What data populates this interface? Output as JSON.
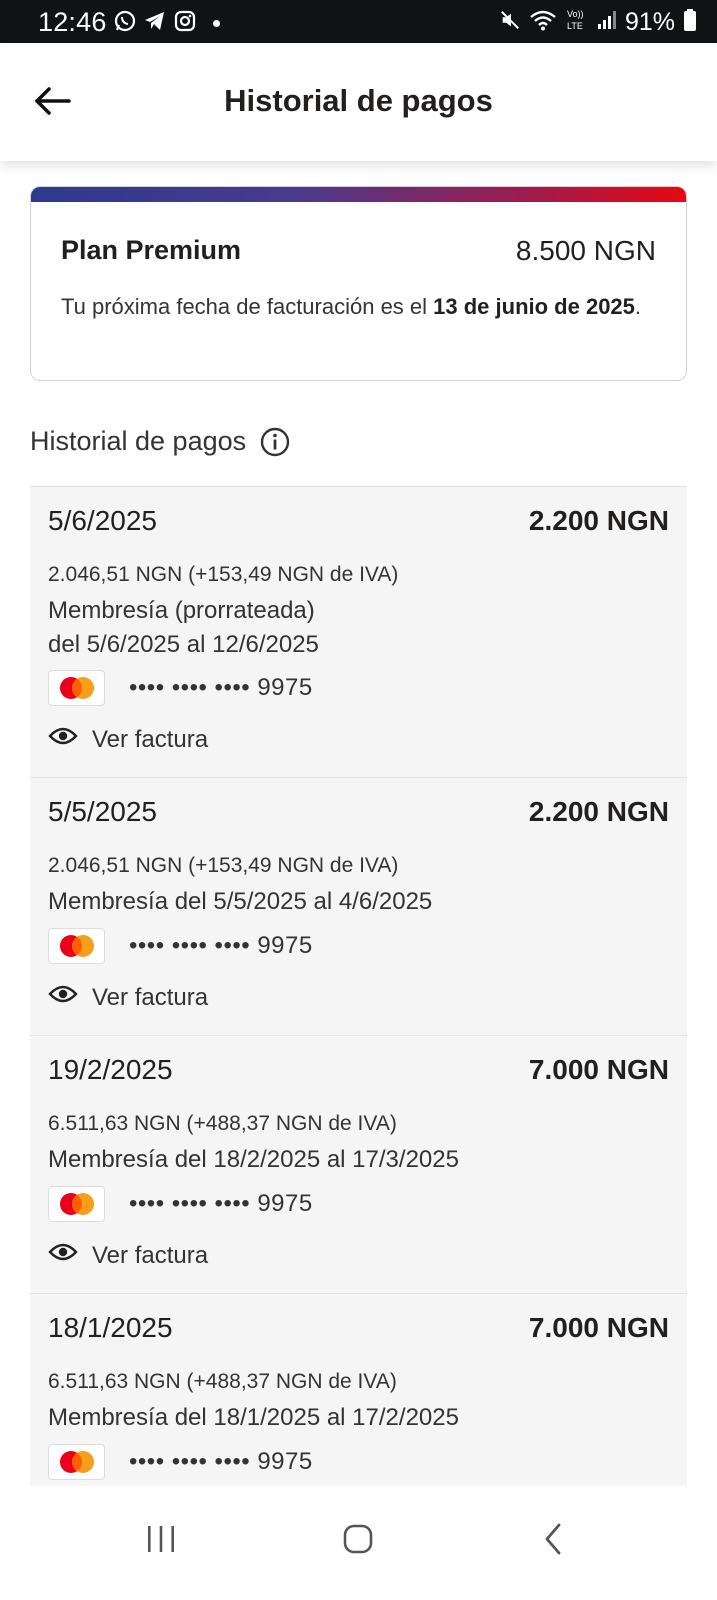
{
  "status_bar": {
    "time": "12:46",
    "battery": "91%",
    "left_icons": [
      "whatsapp-icon",
      "telegram-icon",
      "instagram-icon"
    ],
    "right_icons": [
      "mute-icon",
      "wifi-icon",
      "volte-icon",
      "signal-icon",
      "battery-icon"
    ]
  },
  "header": {
    "title": "Historial de pagos",
    "back_icon": "arrow-left-icon"
  },
  "plan": {
    "name": "Plan Premium",
    "price": "8.500 NGN",
    "note_prefix": "Tu próxima fecha de facturación es el ",
    "note_date": "13 de junio de 2025",
    "note_suffix": "."
  },
  "history": {
    "title": "Historial de pagos",
    "info_icon": "info-icon"
  },
  "payments": [
    {
      "date": "5/6/2025",
      "amount": "2.200 NGN",
      "tax": "2.046,51 NGN (+153,49 NGN de IVA)",
      "desc_line1": "Membresía (prorrateada)",
      "desc_line2": "del 5/6/2025 al 12/6/2025",
      "card": "•••• •••• •••• 9975",
      "invoice": "Ver factura"
    },
    {
      "date": "5/5/2025",
      "amount": "2.200 NGN",
      "tax": "2.046,51 NGN (+153,49 NGN de IVA)",
      "desc_line1": "Membresía del 5/5/2025 al 4/6/2025",
      "desc_line2": "",
      "card": "•••• •••• •••• 9975",
      "invoice": "Ver factura"
    },
    {
      "date": "19/2/2025",
      "amount": "7.000 NGN",
      "tax": "6.511,63 NGN (+488,37 NGN de IVA)",
      "desc_line1": "Membresía del 18/2/2025 al 17/3/2025",
      "desc_line2": "",
      "card": "•••• •••• •••• 9975",
      "invoice": "Ver factura"
    },
    {
      "date": "18/1/2025",
      "amount": "7.000 NGN",
      "tax": "6.511,63 NGN (+488,37 NGN de IVA)",
      "desc_line1": "Membresía del 18/1/2025 al 17/2/2025",
      "desc_line2": "",
      "card": "•••• •••• •••• 9975",
      "invoice": ""
    }
  ],
  "colors": {
    "brand_red": "#e50914",
    "gradient_start": "#2d3a8c",
    "card_bg": "#f5f5f5",
    "mastercard_red": "#eb001b",
    "mastercard_orange": "#f79e1b"
  },
  "navbar": {
    "icons": [
      "recent-apps-icon",
      "home-icon",
      "back-icon"
    ]
  }
}
